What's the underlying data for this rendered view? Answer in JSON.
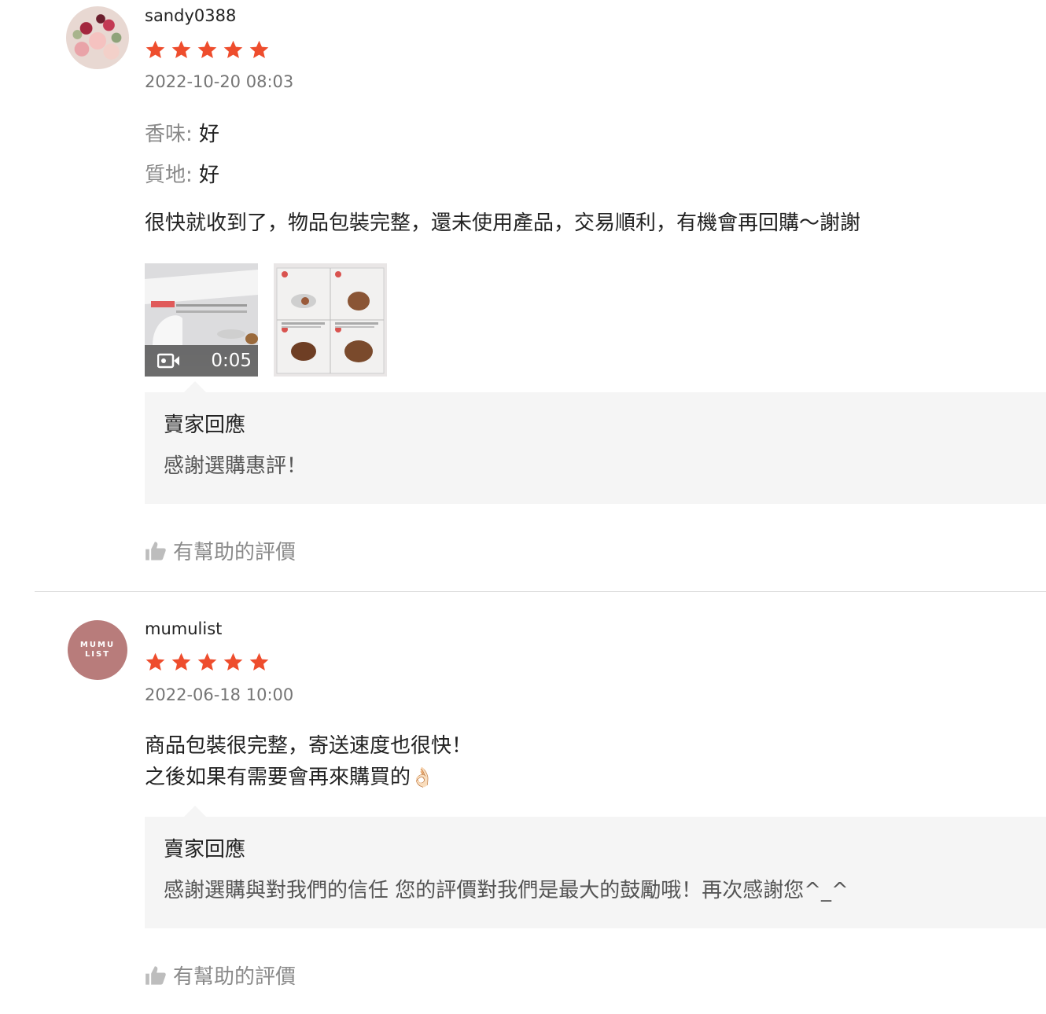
{
  "reviews": [
    {
      "username": "sandy0388",
      "rating": 5,
      "date": "2022-10-20 08:03",
      "attributes": [
        {
          "label": "香味:",
          "value": "好"
        },
        {
          "label": "質地:",
          "value": "好"
        }
      ],
      "comment": "很快就收到了，物品包裝完整，還未使用產品，交易順利，有機會再回購～謝謝",
      "media": {
        "video_duration": "0:05",
        "video_caption": "假髮專用洗髮精使用說"
      },
      "seller_reply": {
        "title": "賣家回應",
        "text": "感謝選購惠評！"
      },
      "helpful_label": "有幫助的評價"
    },
    {
      "username": "mumulist",
      "avatar_text": [
        "MUMU",
        "LIST"
      ],
      "rating": 5,
      "date": "2022-06-18 10:00",
      "comment_lines": [
        "商品包裝很完整，寄送速度也很快！",
        "之後如果有需要會再來購買的"
      ],
      "comment_emoji": "👌🏻",
      "seller_reply": {
        "title": "賣家回應",
        "text": "感謝選購與對我們的信任 您的評價對我們是最大的鼓勵哦！再次感謝您^_^"
      },
      "helpful_label": "有幫助的評價"
    }
  ],
  "colors": {
    "star": "#ee4d2d",
    "reply_bg": "#f5f5f5",
    "muted": "#8a8a8a",
    "mumu_avatar": "#b87c7b"
  }
}
